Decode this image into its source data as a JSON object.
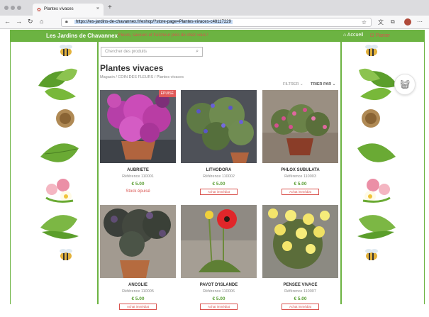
{
  "browser": {
    "tab_title": "Plantes vivaces",
    "url": "https://les-jardins-de-chavannex.fr/eshop/?store-page=Plantes-vivaces-c48117229"
  },
  "site": {
    "brand": "Les Jardins de Chavannex",
    "tagline": "Fleurs, saveurs et fraîcheur près de chez vous !",
    "nav_home": "Accueil",
    "nav_cart": "Panier",
    "accent_color": "#6cb342",
    "alert_color": "#d9534f"
  },
  "search": {
    "placeholder": "Chercher des produits"
  },
  "page": {
    "title": "Plantes vivaces",
    "breadcrumb": "Magasin / COIN DES FLEURS / Plantes vivaces",
    "filter_label": "FILTRER",
    "sort_label": "TRIER PAR"
  },
  "products": [
    {
      "name": "AUBRIETE",
      "ref": "Référence 110001",
      "price": "€ 5.00",
      "status": "Stock épuisé",
      "badge": "ÉPUISÉ"
    },
    {
      "name": "LITHODORA",
      "ref": "Référence 110002",
      "price": "€ 5.00",
      "action": "Achat immédiat"
    },
    {
      "name": "PHLOX SUBULATA",
      "ref": "Référence 110003",
      "price": "€ 5.00",
      "action": "Achat immédiat"
    },
    {
      "name": "ANCOLIE",
      "ref": "Référence 110005",
      "price": "€ 5.00",
      "action": "Achat immédiat"
    },
    {
      "name": "PAVOT D'ISLANDE",
      "ref": "Référence 110006",
      "price": "€ 5.00",
      "action": "Achat immédiat"
    },
    {
      "name": "PENSEE VIVACE",
      "ref": "Référence 110007",
      "price": "€ 5.00",
      "action": "Achat immédiat"
    }
  ]
}
